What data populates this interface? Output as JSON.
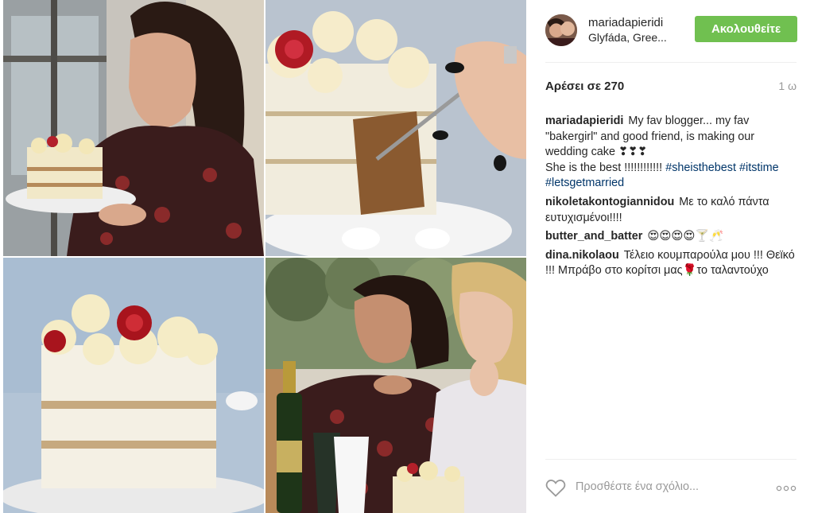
{
  "post": {
    "username": "mariadapieridi",
    "location": "Glyfáda, Gree...",
    "follow_label": "Ακολουθείτε",
    "likes": "Αρέσει σε 270",
    "time": "1 ω"
  },
  "comments": [
    {
      "user": "mariadapieridi",
      "text": "My fav blogger... my fav \"bakergirl\" and good friend, is making our wedding cake",
      "emoji": "❣❣❣",
      "line2": "She is the best !!!!!!!!!!!!",
      "tags": [
        "#sheisthebest",
        "#itstime",
        "#letsgetmarried"
      ]
    },
    {
      "user": "nikoletakontogiannidou",
      "text": "Με το καλό πάντα ευτυχισμένοι!!!!"
    },
    {
      "user": "butter_and_batter",
      "emoji": "😍😍😍😍🍸🥂"
    },
    {
      "user": "dina.nikolaou",
      "text": "Τέλειο κουμπαρούλα μου !!! Θεϊκό !!! Μπράβο στο κορίτσι μας",
      "emoji": "🌹",
      "text2": "το ταλαντούχο"
    }
  ],
  "add_comment": {
    "placeholder": "Προσθέστε ένα σχόλιο..."
  },
  "icons": {
    "like": "heart-icon",
    "more": "more-options-icon"
  },
  "colors": {
    "follow_button": "#70c050",
    "hashtag": "#003569",
    "muted": "#999999"
  }
}
